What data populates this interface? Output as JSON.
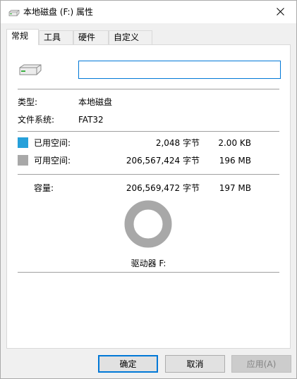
{
  "window": {
    "title": "本地磁盘 (F:) 属性",
    "icon": "drive-icon"
  },
  "tabs": [
    {
      "label": "常规",
      "active": true
    },
    {
      "label": "工具",
      "active": false
    },
    {
      "label": "硬件",
      "active": false
    },
    {
      "label": "自定义",
      "active": false
    }
  ],
  "general": {
    "volume_name_value": "",
    "type_label": "类型:",
    "type_value": "本地磁盘",
    "fs_label": "文件系统:",
    "fs_value": "FAT32",
    "used": {
      "label": "已用空间:",
      "bytes": "2,048 字节",
      "size": "2.00 KB",
      "color": "#26a0da"
    },
    "free": {
      "label": "可用空间:",
      "bytes": "206,567,424 字节",
      "size": "196 MB",
      "color": "#a8a8a8"
    },
    "capacity": {
      "label": "容量:",
      "bytes": "206,569,472 字节",
      "size": "197 MB"
    },
    "drive_caption": "驱动器 F:",
    "used_fraction": 9.9e-06
  },
  "buttons": {
    "ok": "确定",
    "cancel": "取消",
    "apply": "应用(A)"
  }
}
